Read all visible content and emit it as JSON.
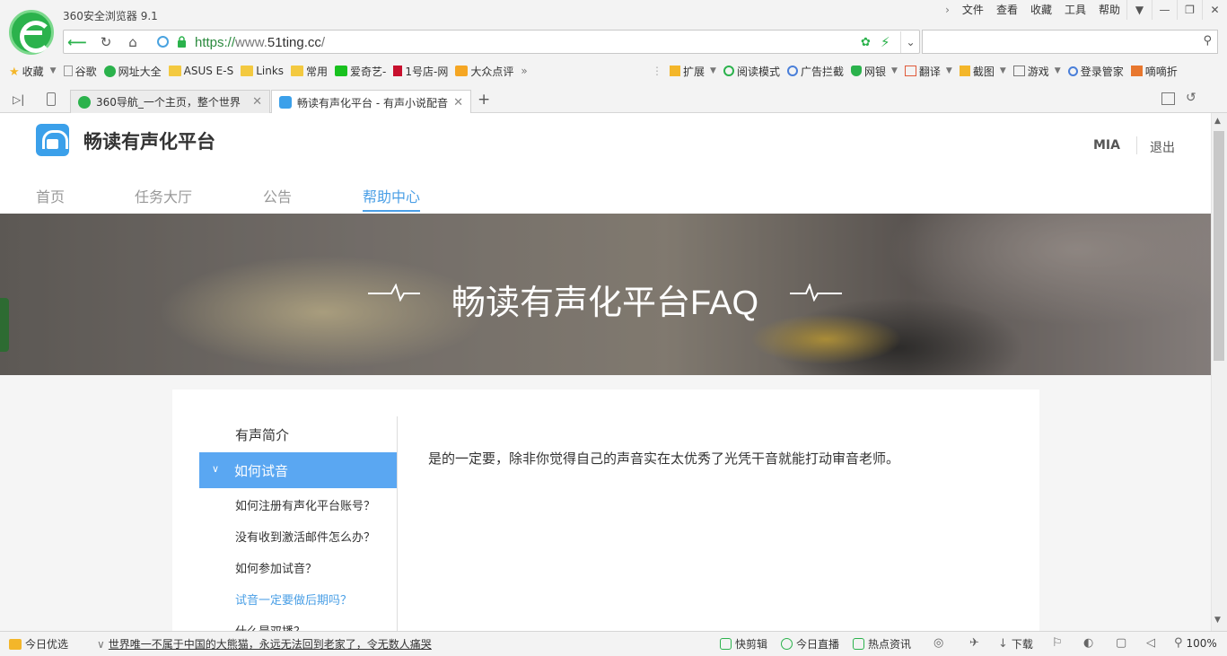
{
  "browser": {
    "app_title": "360安全浏览器 9.1",
    "menu": [
      "文件",
      "查看",
      "收藏",
      "工具",
      "帮助"
    ],
    "url_scheme": "https://",
    "url_sub": "www.",
    "url_domain": "51ting.cc",
    "url_path": "/",
    "bookmarks": [
      {
        "label": "收藏",
        "icon": "star-icon"
      },
      {
        "label": "谷歌",
        "icon": "page-icon"
      },
      {
        "label": "网址大全",
        "icon": "360-icon"
      },
      {
        "label": "ASUS E-S",
        "icon": "folder-icon"
      },
      {
        "label": "Links",
        "icon": "folder-icon"
      },
      {
        "label": "常用",
        "icon": "folder-icon"
      },
      {
        "label": "爱奇艺-",
        "icon": "iqiyi-icon"
      },
      {
        "label": "1号店-网",
        "icon": "yhd-icon"
      },
      {
        "label": "大众点评",
        "icon": "dianping-icon"
      }
    ],
    "toolbar_right": [
      {
        "label": "扩展",
        "icon": "extension-icon"
      },
      {
        "label": "阅读模式",
        "icon": "read-icon"
      },
      {
        "label": "广告拦截",
        "icon": "block-icon"
      },
      {
        "label": "网银",
        "icon": "shield-icon"
      },
      {
        "label": "翻译",
        "icon": "translate-icon"
      },
      {
        "label": "截图",
        "icon": "screenshot-icon"
      },
      {
        "label": "游戏",
        "icon": "game-icon"
      },
      {
        "label": "登录管家",
        "icon": "login-icon"
      },
      {
        "label": "嘀嘀折",
        "icon": "discount-icon"
      }
    ],
    "tabs": [
      {
        "title": "360导航_一个主页，整个世界",
        "active": false
      },
      {
        "title": "畅读有声化平台 - 有声小说配音",
        "active": true
      }
    ],
    "status": {
      "left_label": "今日优选",
      "news": "世界唯一不属于中国的大熊猫，永远无法回到老家了，令无数人痛哭",
      "items": [
        "快剪辑",
        "今日直播",
        "热点资讯",
        "下载"
      ],
      "zoom": "100%"
    },
    "colors": {
      "accent": "#4a9fe6",
      "sidebar_active": "#5aa7f2",
      "brand_green": "#2bb24c"
    }
  },
  "site": {
    "title": "畅读有声化平台",
    "user": "MIA",
    "logout": "退出",
    "nav": [
      {
        "label": "首页",
        "active": false
      },
      {
        "label": "任务大厅",
        "active": false
      },
      {
        "label": "公告",
        "active": false
      },
      {
        "label": "帮助中心",
        "active": true
      }
    ],
    "banner_title": "畅读有声化平台FAQ",
    "sidebar": {
      "sections": [
        {
          "label": "有声简介",
          "active": false
        },
        {
          "label": "如何试音",
          "active": true
        }
      ],
      "items": [
        {
          "label": "如何注册有声化平台账号？",
          "active": false
        },
        {
          "label": "没有收到激活邮件怎么办？",
          "active": false
        },
        {
          "label": "如何参加试音？",
          "active": false
        },
        {
          "label": "试音一定要做后期吗？",
          "active": true
        },
        {
          "label": "什么是双播？",
          "active": false
        }
      ]
    },
    "answer": "是的一定要，除非你觉得自己的声音实在太优秀了光凭干音就能打动审音老师。"
  }
}
